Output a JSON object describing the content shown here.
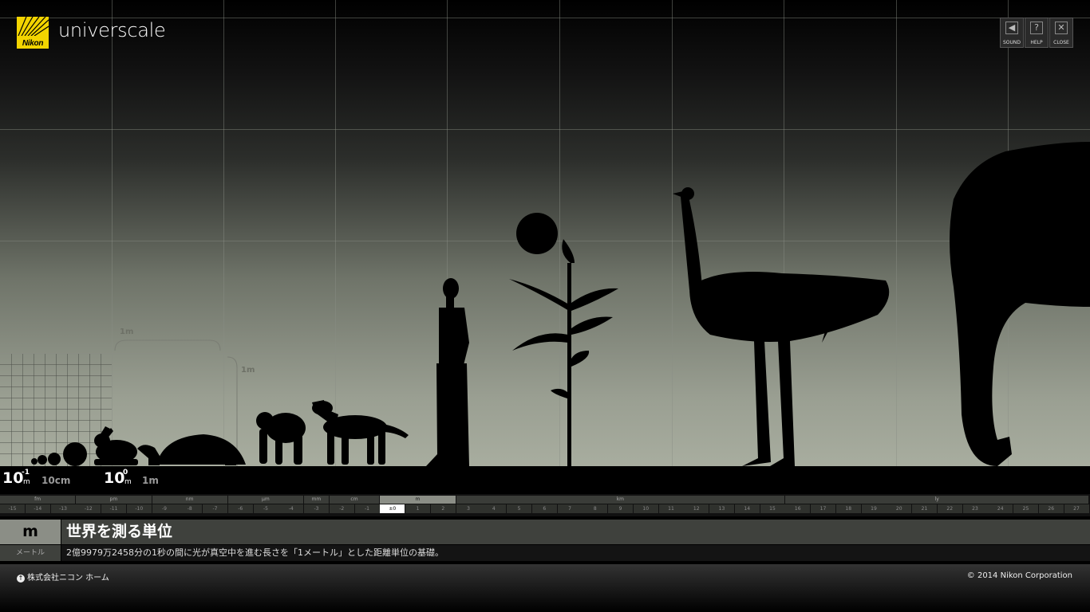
{
  "app": {
    "brand": "Nikon",
    "title": "universcale"
  },
  "controls": [
    {
      "label": "SOUND",
      "icon": "speaker-icon"
    },
    {
      "label": "HELP",
      "icon": "question-icon"
    },
    {
      "label": "CLOSE",
      "icon": "close-icon"
    }
  ],
  "scale_markers": {
    "horizontal": "1m",
    "vertical": "1m"
  },
  "powers": [
    {
      "base": "10",
      "exp": "-1",
      "unit": "m",
      "label": "10cm"
    },
    {
      "base": "10",
      "exp": "0",
      "unit": "m",
      "label": "1m"
    }
  ],
  "ruler": {
    "units": [
      {
        "name": "fm",
        "from": -15,
        "to": -13
      },
      {
        "name": "pm",
        "from": -12,
        "to": -10
      },
      {
        "name": "nm",
        "from": -9,
        "to": -7
      },
      {
        "name": "μm",
        "from": -6,
        "to": -4
      },
      {
        "name": "mm",
        "from": -3,
        "to": -3
      },
      {
        "name": "cm",
        "from": -2,
        "to": -1
      },
      {
        "name": "m",
        "from": 0,
        "to": 2,
        "active": true
      },
      {
        "name": "km",
        "from": 3,
        "to": 15
      },
      {
        "name": "ly",
        "from": 16,
        "to": 27
      }
    ],
    "ticks": [
      "-15",
      "-14",
      "-13",
      "-12",
      "-11",
      "-10",
      "-9",
      "-8",
      "-7",
      "-6",
      "-5",
      "-4",
      "-3",
      "-2",
      "-1",
      "±0",
      "1",
      "2",
      "3",
      "4",
      "5",
      "6",
      "7",
      "8",
      "9",
      "10",
      "11",
      "12",
      "13",
      "14",
      "15",
      "16",
      "17",
      "18",
      "19",
      "20",
      "21",
      "22",
      "23",
      "24",
      "25",
      "26",
      "27"
    ],
    "active_tick": "±0"
  },
  "info": {
    "unit": "m",
    "unit_name": "メートル",
    "headline": "世界を測る単位",
    "description": "2億9979万2458分の1秒の間に光が真空中を進む長さを「1メートル」とした距離単位の基礎。"
  },
  "footer": {
    "home_link": "株式会社ニコン ホーム",
    "copyright": "© 2014 Nikon Corporation"
  },
  "colors": {
    "logo_yellow": "#f3d400",
    "silhouette": "#000000",
    "active_unit": "#8b8e86"
  }
}
